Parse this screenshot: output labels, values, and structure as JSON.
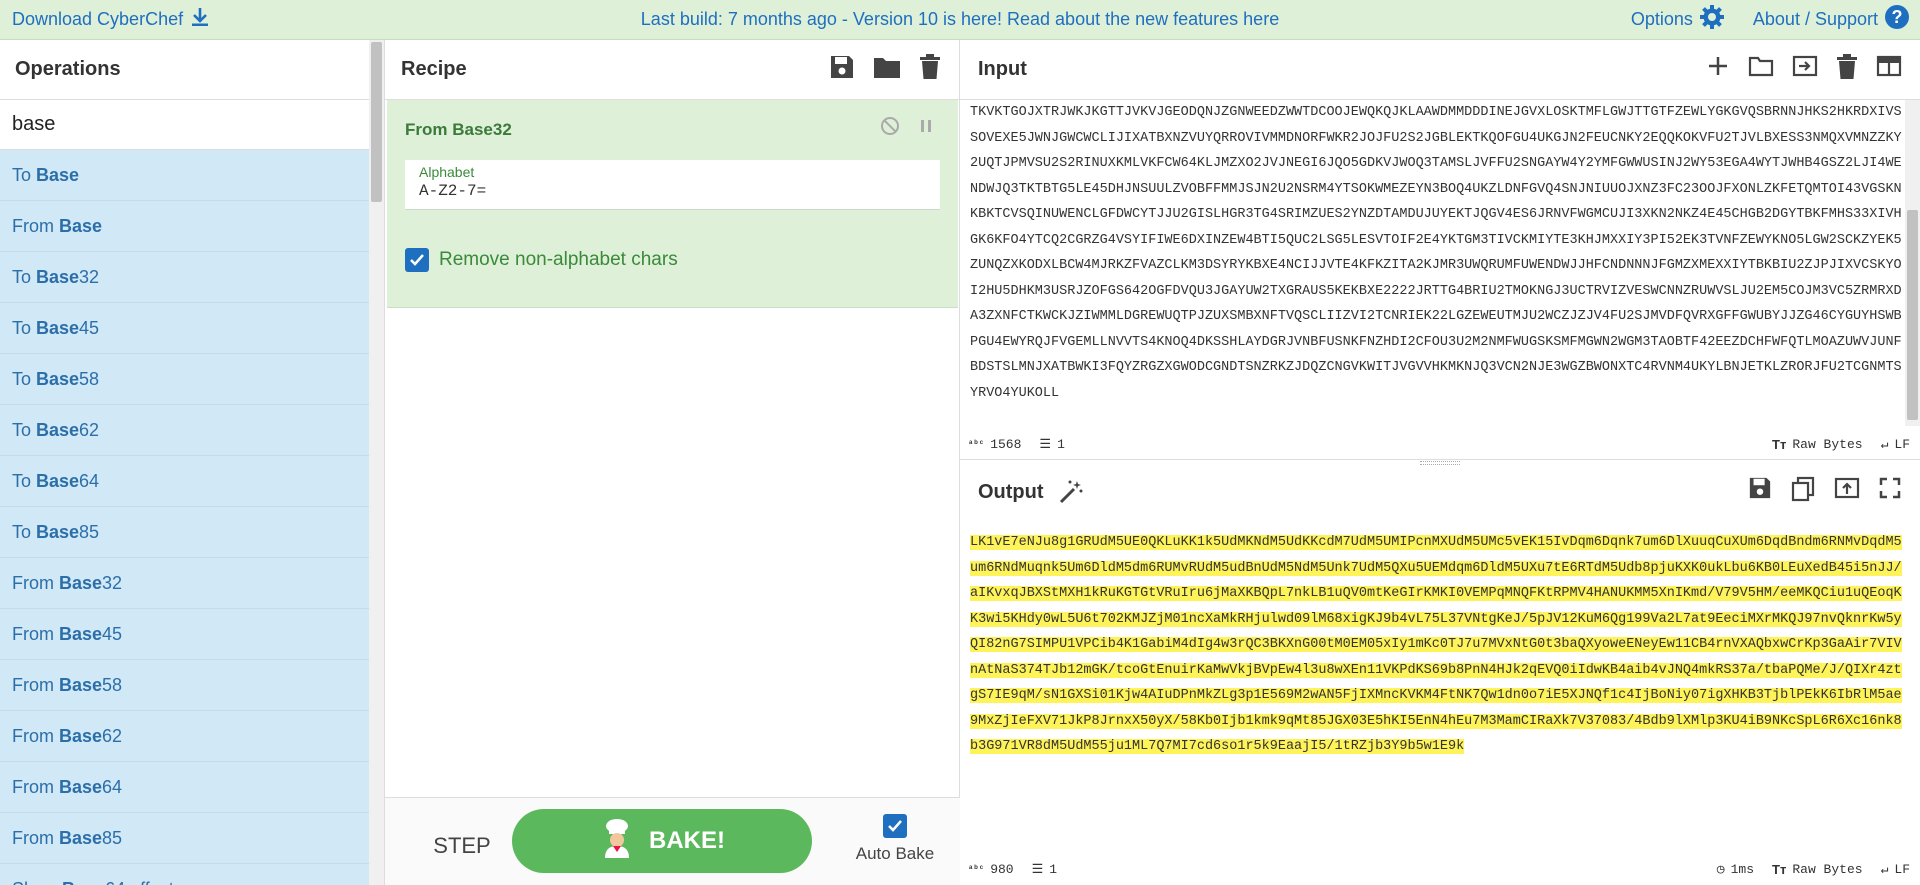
{
  "banner": {
    "download": "Download CyberChef",
    "notice": "Last build: 7 months ago - Version 10 is here! Read about the new features here",
    "options": "Options",
    "about": "About / Support",
    "accent": "#1f6fc0"
  },
  "operations": {
    "title": "Operations",
    "search_value": "base",
    "items": [
      {
        "pre": "To ",
        "bold": "Base",
        "post": ""
      },
      {
        "pre": "From ",
        "bold": "Base",
        "post": ""
      },
      {
        "pre": "To ",
        "bold": "Base",
        "post": "32"
      },
      {
        "pre": "To ",
        "bold": "Base",
        "post": "45"
      },
      {
        "pre": "To ",
        "bold": "Base",
        "post": "58"
      },
      {
        "pre": "To ",
        "bold": "Base",
        "post": "62"
      },
      {
        "pre": "To ",
        "bold": "Base",
        "post": "64"
      },
      {
        "pre": "To ",
        "bold": "Base",
        "post": "85"
      },
      {
        "pre": "From ",
        "bold": "Base",
        "post": "32"
      },
      {
        "pre": "From ",
        "bold": "Base",
        "post": "45"
      },
      {
        "pre": "From ",
        "bold": "Base",
        "post": "58"
      },
      {
        "pre": "From ",
        "bold": "Base",
        "post": "62"
      },
      {
        "pre": "From ",
        "bold": "Base",
        "post": "64"
      },
      {
        "pre": "From ",
        "bold": "Base",
        "post": "85"
      },
      {
        "pre": "Show ",
        "bold": "Base",
        "post": "64 offsets"
      }
    ]
  },
  "recipe": {
    "title": "Recipe",
    "operation": {
      "name": "From Base32",
      "alphabet_label": "Alphabet",
      "alphabet_value": "A-Z2-7=",
      "remove_label": "Remove non-alphabet chars",
      "remove_checked": true
    },
    "step_label": "STEP",
    "bake_label": "BAKE!",
    "autobake_label": "Auto Bake",
    "autobake_checked": true
  },
  "input": {
    "title": "Input",
    "text": "TKVKTGOJXTRJWKJKGTTJVKVJGEODQNJZGNWEEDZWWTDCOOJEWQKQJKLAAWDMMDDDINEJGVXLOSKTMFLGWJTTGTFZEWLYGKGVQSBRNNJHKS2HKRDXIVSSOVEXE5JWNJGWCWCLIJIXATBXNZVUYQRROVIVMMDNORFWKR2JOJFU2S2JGBLEKTKQOFGU4UKGJN2FEUCNKY2EQQKOKVFU2TJVLBXESS3NMQXVMNZZKY2UQTJPMVSU2S2RINUXKMLVKFCW64KLJMZXO2JVJNEGI6JQO5GDKVJWOQ3TAMSLJVFFU2SNGAYW4Y2YMFGWWUSINJ2WY53EGA4WYTJWHB4GSZ2LJI4WENDWJQ3TKTBTG5LE45DHJNSUULZVOBFFMMJSJN2U2NSRM4YTSOKWMEZEYN3BOQ4UKZLDNFGVQ4SNJNIUUOJXNZ3FC23OOJFXONLZKFETQMTOI43VGSKNKBKTCVSQINUWENCLGFDWCYTJJU2GISLHGR3TG4SRIMZUES2YNZDTAMDUJUYEKTJQGV4ES6JRNVFWGMCUJI3XKN2NKZ4E45CHGB2DGYTBKFMHS33XIVHGK6KFO4YTCQ2CGRZG4VSYIFIWE6DXINZEW4BTI5QUC2LSG5LESVTOIF2E4YKTGM3TIVCKMIYTE3KHJMXXIY3PI52EK3TVNFZEWYKNO5LGW2SCKZYEK5ZUNQZXKODXLBCW4MJRKZFVAZCLKM3DSYRYKBXE4NCIJJVTE4KFKZITA2KJMR3UWQRUMFUWENDWJJHFCNDNNNJFGMZXMEXXIYTBKBIU2ZJPJIXVCSKYOI2HU5DHKM3USRJZOFGS642OGFDVQU3JGAYUW2TXGRAUS5KEKBXE2222JRTTG4BRIU2TMOKNGJ3UCTRVIZVESWCNNZRUWVSLJU2EM5COJM3VC5ZRMRXDA3ZXNFCTKWCKJZIWMMLDGREWUQTPJZUXSMBXNFTVQSCLIIZVI2TCNRIEK22LGZEWEUTMJU2WCZJZJV4FU2SJMVDFQVRXGFFGWUBYJJZG46CYGUYHSWBPGU4EWYRQJFVGEMLLNVVTS4KNOQ4DKSSHLAYDGRJVNBFUSNKFNZHDI2CFOU3U2M2NMFWUGSKSMFMGWN2WGM3TAOBTF42EEZDCHFWFQTLMOAZUWVJUNFBDSTSLMNJXATBWKI3FQYZRGZXGWODCGNDTSNZRKZJDQZCNGVKWITJVGVVHKMKNJQ3VCN2NJE3WGZBWONXTC4RVNM4UKYLBNJETKLZRORJFU2TCGNMTSYRVO4YUKOLL",
    "length": "1568",
    "lines": "1",
    "encoding": "Raw Bytes",
    "eol": "LF"
  },
  "output": {
    "title": "Output",
    "text": "LK1vE7eNJu8g1GRUdM5UE0QKLuKK1k5UdMKNdM5UdKKcdM7UdM5UMIPcnMXUdM5UMc5vEK15IvDqm6Dqnk7um6DlXuuqCuXUm6DqdBndm6RNMvDqdM5um6RNdMuqnk5Um6DldM5dm6RUMvRUdM5udBnUdM5NdM5Unk7UdM5QXu5UEMdqm6DldM5UXu7tE6RTdM5Udb8pjuKXK0ukLbu6KB0LEuXedB45i5nJJ/aIKvxqJBXStMXH1kRuKGTGtVRuIru6jMaXKBQpL7nkLB1uQV0mtKeGIrKMKI0VEMPqMNQFKtRPMV4HANUKMM5XnIKmd/V79V5HM/eeMKQCiu1uQEoqKK3wi5KHdy0wL5U6t702KMJZjM01ncXaMkRHjulwd09lM68xigKJ9b4vL75L37VNtgKeJ/5pJV12KuM6Qg199Va2L7at9EeciMXrMKQJ97nvQknrKw5yQI82nG7SIMPU1VPCib4K1GabiM4dIg4w3rQC3BKXnG00tM0EM05xIy1mKc0TJ7u7MVxNtG0t3baQXyoweENeyEw11CB4rnVXAQbxwCrKp3GaAir7VIVnAtNaS374TJb12mGK/tcoGtEnuirKaMwVkjBVpEw4l3u8wXEn11VKPdKS69b8PnN4HJk2qEVQ0iIdwKB4aib4vJNQ4mkRS37a/tbaPQMe/J/QIXr4ztgS7IE9qM/sN1GXSi01Kjw4AIuDPnMkZLg3p1E569M2wAN5FjIXMncKVKM4FtNK7Qw1dn0o7iE5XJNQf1c4IjBoNiy07igXHKB3TjblPEkK6IbRlM5ae9MxZjIeFXV71JkP8JrnxX50yX/58Kb0Ijb1kmk9qMt85JGX03E5hKI5EnN4hEu7M3MamCIRaXk7V37083/4Bdb9lXMlp3KU4iB9NKcSpL6R6Xc16nk8b3G971VR8dM5UdM55ju1ML7Q7MI7cd6so1r5k9EaajI5/1tRZjb3Y9b5w1E9k",
    "length": "980",
    "lines": "1",
    "time": "1ms",
    "encoding": "Raw Bytes",
    "eol": "LF"
  }
}
